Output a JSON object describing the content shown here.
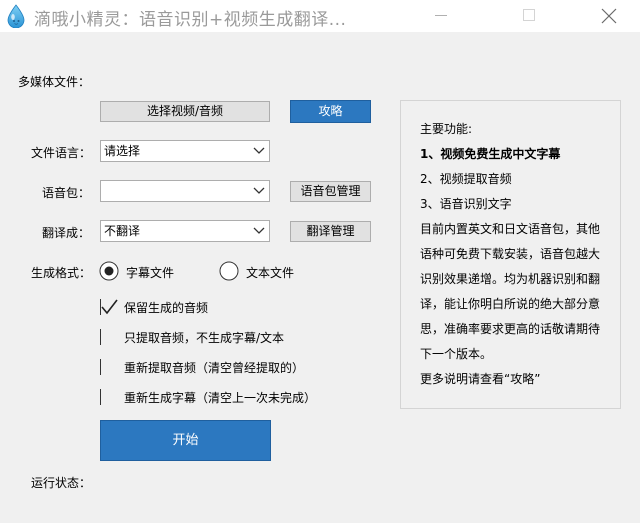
{
  "window": {
    "title": "滴哦小精灵：语音识别+视频生成翻译..."
  },
  "labels": {
    "media_files": "多媒体文件：",
    "file_language": "文件语言：",
    "voice_pack": "语音包：",
    "translate_to": "翻译成：",
    "output_format": "生成格式：",
    "run_status": "运行状态："
  },
  "buttons": {
    "select_media": "选择视频/音频",
    "guide": "攻略",
    "voice_pack_manage": "语音包管理",
    "translate_manage": "翻译管理",
    "start": "开始"
  },
  "selects": {
    "file_language": "请选择",
    "voice_pack": "",
    "translate_to": "不翻译"
  },
  "output_format": {
    "options": [
      "字幕文件",
      "文本文件"
    ],
    "selected": "字幕文件"
  },
  "checkboxes": [
    {
      "label": "保留生成的音频",
      "checked": true
    },
    {
      "label": "只提取音频，不生成字幕/文本",
      "checked": false
    },
    {
      "label": "重新提取音频（清空曾经提取的）",
      "checked": false
    },
    {
      "label": "重新生成字幕（清空上一次未完成）",
      "checked": false
    }
  ],
  "info": {
    "heading": "主要功能:",
    "lines": [
      "1、视频免费生成中文字幕",
      "2、视频提取音频",
      "3、语音识别文字",
      "目前内置英文和日文语音包，其他",
      "语种可免费下载安装，语音包越大",
      "识别效果递增。均为机器识别和翻",
      "译，能让你明白所说的绝大部分意",
      "思，准确率要求更高的话敬请期待",
      "下一个版本。",
      "更多说明请查看“攻略”"
    ]
  },
  "colors": {
    "accent": "#2c78c0",
    "background": "#f0f0f0",
    "title_text": "#9a9a9a"
  },
  "icons": {
    "app": "water-drop-icon",
    "minimize": "minimize-icon",
    "maximize": "maximize-icon",
    "close": "close-icon",
    "dropdown": "chevron-down-icon"
  }
}
